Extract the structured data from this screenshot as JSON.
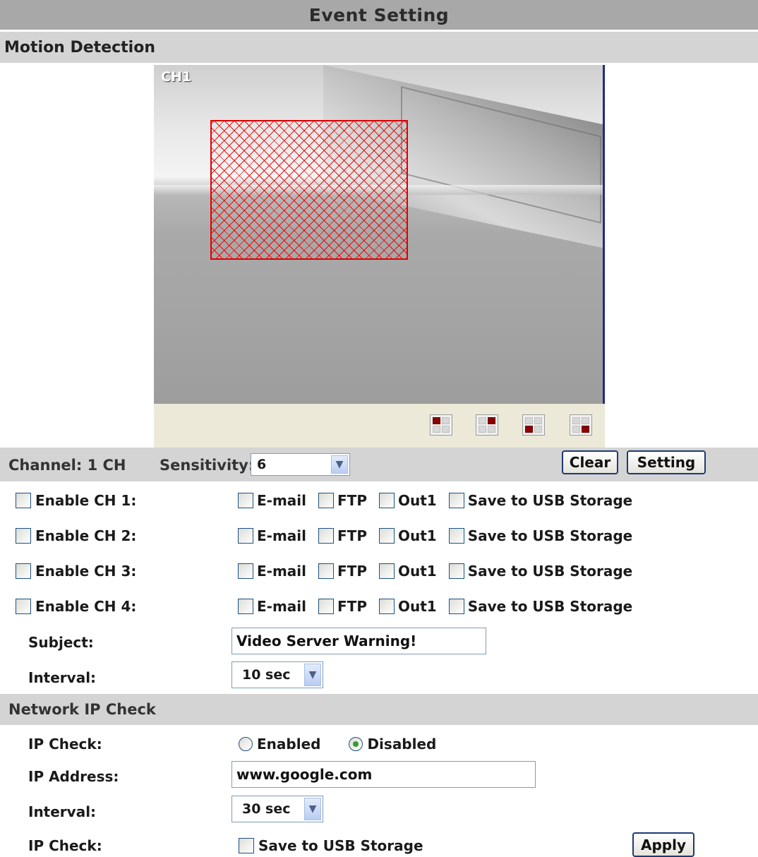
{
  "title": "Event Setting",
  "motion": {
    "section_title": "Motion Detection",
    "video_label": "CH1",
    "grid_buttons": [
      "top-left-quadrant",
      "top-right-quadrant",
      "bottom-left-quadrant",
      "bottom-right-quadrant"
    ]
  },
  "channel_bar": {
    "channel_label": "Channel: 1 CH",
    "sensitivity_label": "Sensitivity:",
    "sensitivity_value": "6",
    "clear_label": "Clear",
    "setting_label": "Setting"
  },
  "channels": [
    {
      "enable_label": "Enable CH 1:",
      "email": "E-mail",
      "ftp": "FTP",
      "out": "Out1",
      "usb": "Save to USB Storage"
    },
    {
      "enable_label": "Enable CH 2:",
      "email": "E-mail",
      "ftp": "FTP",
      "out": "Out1",
      "usb": "Save to USB Storage"
    },
    {
      "enable_label": "Enable CH 3:",
      "email": "E-mail",
      "ftp": "FTP",
      "out": "Out1",
      "usb": "Save to USB Storage"
    },
    {
      "enable_label": "Enable CH 4:",
      "email": "E-mail",
      "ftp": "FTP",
      "out": "Out1",
      "usb": "Save to USB Storage"
    }
  ],
  "subject": {
    "label": "Subject:",
    "value": "Video Server Warning!"
  },
  "interval": {
    "label": "Interval:",
    "value": "10 sec"
  },
  "network": {
    "section_title": "Network IP Check",
    "ip_check_label": "IP Check:",
    "enabled_label": "Enabled",
    "disabled_label": "Disabled",
    "selected": "Disabled",
    "ip_address_label": "IP Address:",
    "ip_address_value": "www.google.com",
    "interval_label": "Interval:",
    "interval_value": "30 sec",
    "ip_check2_label": "IP Check:",
    "usb_label": "Save to USB Storage",
    "apply_label": "Apply"
  },
  "colors": {
    "title_bar": "#a8a8a8",
    "section_bar": "#d4d4d4",
    "motion_grid": "#e00000",
    "grid_active": "#8b0000"
  }
}
